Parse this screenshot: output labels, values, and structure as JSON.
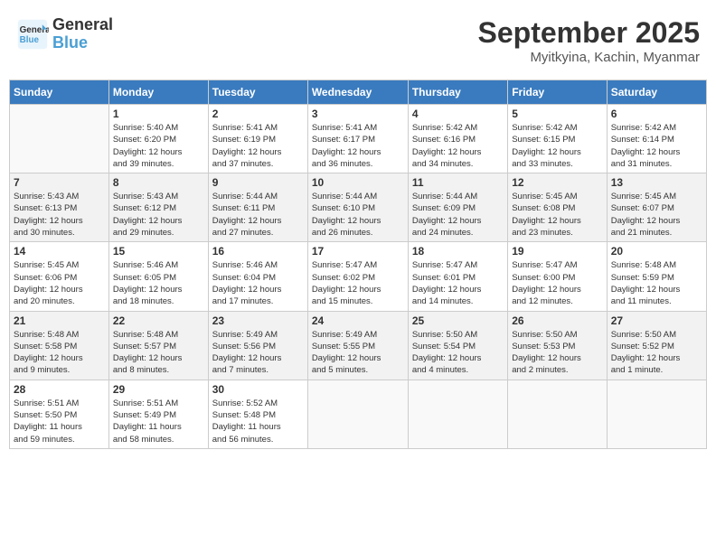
{
  "logo": {
    "line1": "General",
    "line2": "Blue"
  },
  "title": "September 2025",
  "location": "Myitkyina, Kachin, Myanmar",
  "headers": [
    "Sunday",
    "Monday",
    "Tuesday",
    "Wednesday",
    "Thursday",
    "Friday",
    "Saturday"
  ],
  "weeks": [
    [
      {
        "day": "",
        "info": ""
      },
      {
        "day": "1",
        "info": "Sunrise: 5:40 AM\nSunset: 6:20 PM\nDaylight: 12 hours\nand 39 minutes."
      },
      {
        "day": "2",
        "info": "Sunrise: 5:41 AM\nSunset: 6:19 PM\nDaylight: 12 hours\nand 37 minutes."
      },
      {
        "day": "3",
        "info": "Sunrise: 5:41 AM\nSunset: 6:17 PM\nDaylight: 12 hours\nand 36 minutes."
      },
      {
        "day": "4",
        "info": "Sunrise: 5:42 AM\nSunset: 6:16 PM\nDaylight: 12 hours\nand 34 minutes."
      },
      {
        "day": "5",
        "info": "Sunrise: 5:42 AM\nSunset: 6:15 PM\nDaylight: 12 hours\nand 33 minutes."
      },
      {
        "day": "6",
        "info": "Sunrise: 5:42 AM\nSunset: 6:14 PM\nDaylight: 12 hours\nand 31 minutes."
      }
    ],
    [
      {
        "day": "7",
        "info": "Sunrise: 5:43 AM\nSunset: 6:13 PM\nDaylight: 12 hours\nand 30 minutes."
      },
      {
        "day": "8",
        "info": "Sunrise: 5:43 AM\nSunset: 6:12 PM\nDaylight: 12 hours\nand 29 minutes."
      },
      {
        "day": "9",
        "info": "Sunrise: 5:44 AM\nSunset: 6:11 PM\nDaylight: 12 hours\nand 27 minutes."
      },
      {
        "day": "10",
        "info": "Sunrise: 5:44 AM\nSunset: 6:10 PM\nDaylight: 12 hours\nand 26 minutes."
      },
      {
        "day": "11",
        "info": "Sunrise: 5:44 AM\nSunset: 6:09 PM\nDaylight: 12 hours\nand 24 minutes."
      },
      {
        "day": "12",
        "info": "Sunrise: 5:45 AM\nSunset: 6:08 PM\nDaylight: 12 hours\nand 23 minutes."
      },
      {
        "day": "13",
        "info": "Sunrise: 5:45 AM\nSunset: 6:07 PM\nDaylight: 12 hours\nand 21 minutes."
      }
    ],
    [
      {
        "day": "14",
        "info": "Sunrise: 5:45 AM\nSunset: 6:06 PM\nDaylight: 12 hours\nand 20 minutes."
      },
      {
        "day": "15",
        "info": "Sunrise: 5:46 AM\nSunset: 6:05 PM\nDaylight: 12 hours\nand 18 minutes."
      },
      {
        "day": "16",
        "info": "Sunrise: 5:46 AM\nSunset: 6:04 PM\nDaylight: 12 hours\nand 17 minutes."
      },
      {
        "day": "17",
        "info": "Sunrise: 5:47 AM\nSunset: 6:02 PM\nDaylight: 12 hours\nand 15 minutes."
      },
      {
        "day": "18",
        "info": "Sunrise: 5:47 AM\nSunset: 6:01 PM\nDaylight: 12 hours\nand 14 minutes."
      },
      {
        "day": "19",
        "info": "Sunrise: 5:47 AM\nSunset: 6:00 PM\nDaylight: 12 hours\nand 12 minutes."
      },
      {
        "day": "20",
        "info": "Sunrise: 5:48 AM\nSunset: 5:59 PM\nDaylight: 12 hours\nand 11 minutes."
      }
    ],
    [
      {
        "day": "21",
        "info": "Sunrise: 5:48 AM\nSunset: 5:58 PM\nDaylight: 12 hours\nand 9 minutes."
      },
      {
        "day": "22",
        "info": "Sunrise: 5:48 AM\nSunset: 5:57 PM\nDaylight: 12 hours\nand 8 minutes."
      },
      {
        "day": "23",
        "info": "Sunrise: 5:49 AM\nSunset: 5:56 PM\nDaylight: 12 hours\nand 7 minutes."
      },
      {
        "day": "24",
        "info": "Sunrise: 5:49 AM\nSunset: 5:55 PM\nDaylight: 12 hours\nand 5 minutes."
      },
      {
        "day": "25",
        "info": "Sunrise: 5:50 AM\nSunset: 5:54 PM\nDaylight: 12 hours\nand 4 minutes."
      },
      {
        "day": "26",
        "info": "Sunrise: 5:50 AM\nSunset: 5:53 PM\nDaylight: 12 hours\nand 2 minutes."
      },
      {
        "day": "27",
        "info": "Sunrise: 5:50 AM\nSunset: 5:52 PM\nDaylight: 12 hours\nand 1 minute."
      }
    ],
    [
      {
        "day": "28",
        "info": "Sunrise: 5:51 AM\nSunset: 5:50 PM\nDaylight: 11 hours\nand 59 minutes."
      },
      {
        "day": "29",
        "info": "Sunrise: 5:51 AM\nSunset: 5:49 PM\nDaylight: 11 hours\nand 58 minutes."
      },
      {
        "day": "30",
        "info": "Sunrise: 5:52 AM\nSunset: 5:48 PM\nDaylight: 11 hours\nand 56 minutes."
      },
      {
        "day": "",
        "info": ""
      },
      {
        "day": "",
        "info": ""
      },
      {
        "day": "",
        "info": ""
      },
      {
        "day": "",
        "info": ""
      }
    ]
  ]
}
